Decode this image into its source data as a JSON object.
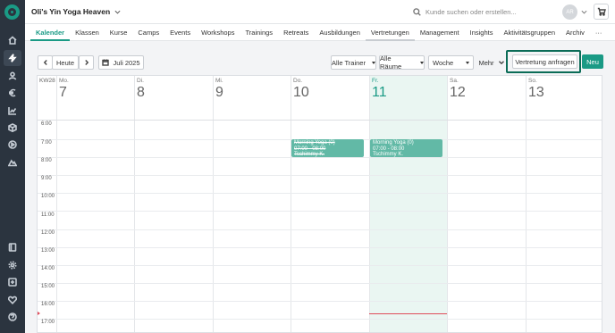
{
  "topbar": {
    "studio_name": "Oli's Yin Yoga Heaven",
    "search_placeholder": "Kunde suchen oder erstellen...",
    "avatar_initials": "AR"
  },
  "nav": {
    "tabs": [
      {
        "label": "Kalender",
        "active": true
      },
      {
        "label": "Klassen"
      },
      {
        "label": "Kurse"
      },
      {
        "label": "Camps"
      },
      {
        "label": "Events"
      },
      {
        "label": "Workshops"
      },
      {
        "label": "Trainings"
      },
      {
        "label": "Retreats"
      },
      {
        "label": "Ausbildungen"
      },
      {
        "label": "Vertretungen"
      },
      {
        "label": "Management"
      },
      {
        "label": "Insights"
      },
      {
        "label": "Aktivitätsgruppen"
      },
      {
        "label": "Archiv"
      },
      {
        "label": "···"
      }
    ]
  },
  "toolbar": {
    "today_label": "Heute",
    "month_label": "Juli 2025",
    "trainer_filter": "Alle Trainer",
    "room_filter": "Alle Räume",
    "view_select": "Woche",
    "more_label": "Mehr",
    "request_sub_label": "Vertretung anfragen",
    "new_label": "Neu"
  },
  "calendar": {
    "week_label": "KW28",
    "days": [
      {
        "name": "Mo.",
        "num": "7"
      },
      {
        "name": "Di.",
        "num": "8"
      },
      {
        "name": "Mi.",
        "num": "9"
      },
      {
        "name": "Do.",
        "num": "10"
      },
      {
        "name": "Fr.",
        "num": "11",
        "today": true
      },
      {
        "name": "Sa.",
        "num": "12"
      },
      {
        "name": "So.",
        "num": "13"
      }
    ],
    "times": [
      "6:00",
      "7:00",
      "8:00",
      "9:00",
      "10:00",
      "11:00",
      "12:00",
      "13:00",
      "14:00",
      "15:00",
      "16:00",
      "17:00"
    ],
    "events": [
      {
        "title": "Morning Yoga (0)",
        "time": "07:00 - 08:00",
        "trainer": "Tschimmy K.",
        "cancelled": true
      },
      {
        "title": "Morning Yoga (0)",
        "time": "07:00 - 08:00",
        "trainer": "Tschimmy K.",
        "cancelled": false
      }
    ]
  },
  "colors": {
    "accent": "#1a9a85",
    "sidebar": "#2b343f",
    "event": "#62b9a6",
    "today_bg": "#eaf6f2",
    "now_line": "#e04b5a",
    "highlight": "#0b6c57"
  },
  "sidebar_icons": [
    "home-icon",
    "bolt-icon",
    "user-icon",
    "euro-icon",
    "chart-icon",
    "box-icon",
    "play-icon",
    "mountain-icon",
    "book-icon",
    "gear-icon",
    "plus-square-icon",
    "heart-icon",
    "help-icon"
  ]
}
